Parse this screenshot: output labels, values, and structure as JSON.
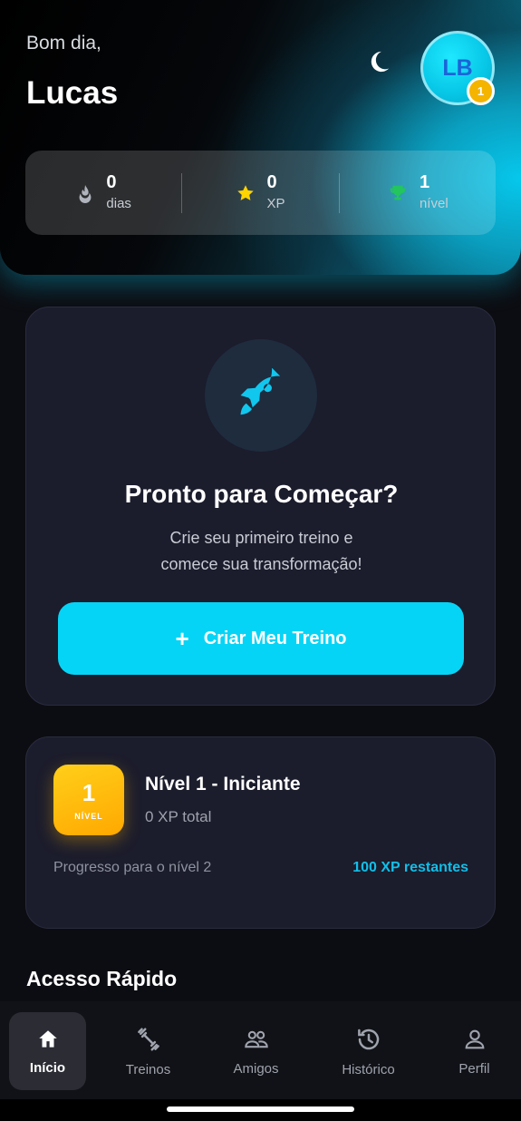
{
  "header": {
    "greeting": "Bom dia,",
    "username": "Lucas",
    "avatar_initials": "LB",
    "avatar_level_badge": "1",
    "theme_icon": "moon-icon"
  },
  "stats": [
    {
      "icon": "flame-icon",
      "value": "0",
      "label": "dias"
    },
    {
      "icon": "star-icon",
      "value": "0",
      "label": "XP"
    },
    {
      "icon": "trophy-icon",
      "value": "1",
      "label": "nível"
    }
  ],
  "start_card": {
    "icon": "rocket-icon",
    "title": "Pronto para Começar?",
    "subtitle_line1": "Crie seu primeiro treino e",
    "subtitle_line2": "comece sua transformação!",
    "button_icon": "+",
    "button_label": "Criar Meu Treino"
  },
  "level_card": {
    "badge_number": "1",
    "badge_text": "NÍVEL",
    "title": "Nível 1 - Iniciante",
    "xp_total": "0 XP total",
    "progress_label": "Progresso para o nível 2",
    "remaining": "100 XP restantes"
  },
  "quick_access": {
    "title": "Acesso Rápido"
  },
  "nav": [
    {
      "label": "Início",
      "icon": "home-icon",
      "active": true
    },
    {
      "label": "Treinos",
      "icon": "dumbbell-icon",
      "active": false
    },
    {
      "label": "Amigos",
      "icon": "friends-icon",
      "active": false
    },
    {
      "label": "Histórico",
      "icon": "history-icon",
      "active": false
    },
    {
      "label": "Perfil",
      "icon": "person-icon",
      "active": false
    }
  ],
  "colors": {
    "accent": "#06d4f6",
    "level_gold": "#ffb300",
    "card_bg": "#1b1c2c",
    "page_bg": "#0c0d12"
  }
}
